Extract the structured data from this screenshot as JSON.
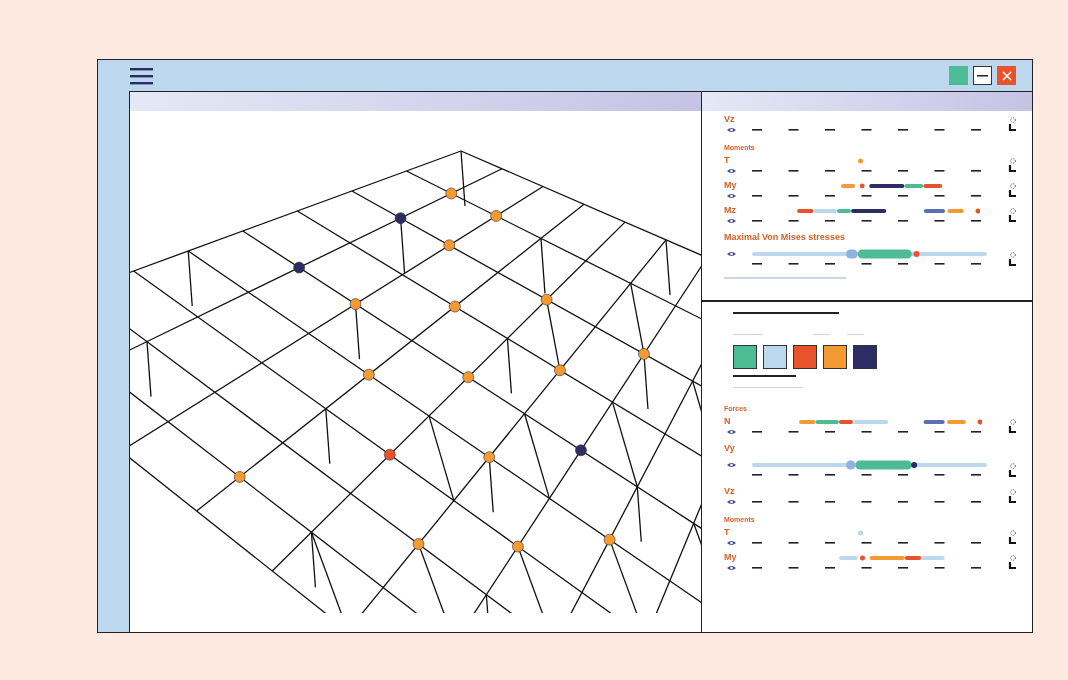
{
  "results_top": {
    "items": [
      {
        "kind": "row",
        "label": "Vz"
      },
      {
        "kind": "heading",
        "label": "Moments"
      },
      {
        "kind": "row",
        "label": "T"
      },
      {
        "kind": "row",
        "label": "My"
      },
      {
        "kind": "row",
        "label": "Mz"
      },
      {
        "kind": "stress",
        "label": "Maximal  Von Mises stresses"
      }
    ]
  },
  "legend": {
    "swatches": [
      {
        "color": "#4dbb94"
      },
      {
        "color": "#bcd8ee"
      },
      {
        "color": "#e8532b"
      },
      {
        "color": "#f39a32"
      },
      {
        "color": "#2b2d63"
      }
    ]
  },
  "results_bottom": {
    "items": [
      {
        "kind": "heading",
        "label": "Forces"
      },
      {
        "kind": "row",
        "label": "N"
      },
      {
        "kind": "stress",
        "label": "Vy"
      },
      {
        "kind": "row",
        "label": "Vz"
      },
      {
        "kind": "heading",
        "label": "Moments"
      },
      {
        "kind": "row",
        "label": "T"
      },
      {
        "kind": "row",
        "label": "My"
      }
    ]
  }
}
